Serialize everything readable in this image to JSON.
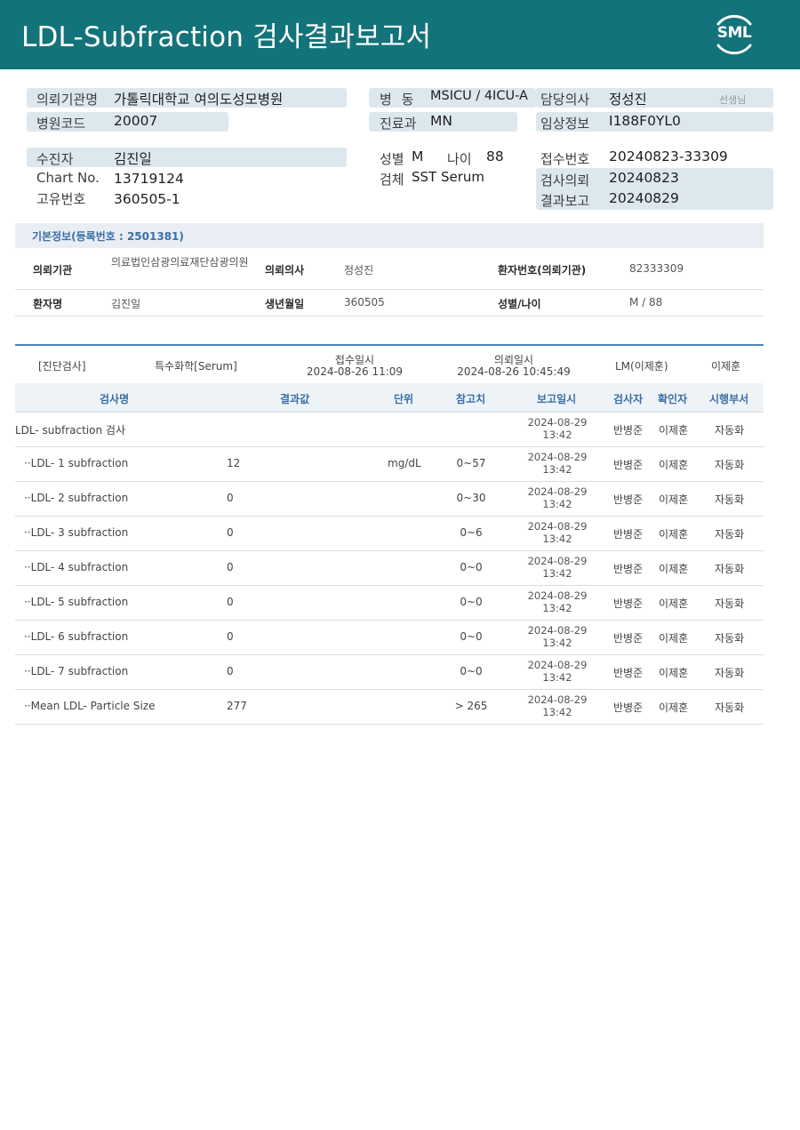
{
  "header": {
    "title": "LDL-Subfraction 검사결과보고서",
    "logo_text": "SML"
  },
  "info": {
    "institution_label": "의뢰기관명",
    "institution_value": "가톨릭대학교 여의도성모병원",
    "hospital_code_label": "병원코드",
    "hospital_code_value": "20007",
    "ward_label": "병  동",
    "ward_value": "MSICU / 4ICU-A",
    "dept_label": "진료과",
    "dept_value": "MN",
    "doctor_label": "담당의사",
    "doctor_value": "정성진",
    "doctor_suffix": "선생님",
    "clinical_label": "임상정보",
    "clinical_value": "I188F0YL0",
    "patient_label": "수진자",
    "patient_value": "김진일",
    "chart_label": "Chart No.",
    "chart_value": "13719124",
    "unique_label": "고유번호",
    "unique_value": "360505-1",
    "sex_label": "성별",
    "sex_value": "M",
    "age_label": "나이",
    "age_value": "88",
    "specimen_label": "검체",
    "specimen_value": "SST Serum",
    "receipt_label": "접수번호",
    "receipt_value": "20240823-33309",
    "request_label": "검사의뢰",
    "request_value": "20240823",
    "report_label": "결과보고",
    "report_value": "20240829"
  },
  "basic": {
    "section_title": "기본정보(등록번호 : 2501381)",
    "inst_label": "의뢰기관",
    "inst_value": "의료법인삼광의료재단삼광의원",
    "req_doctor_label": "의뢰의사",
    "req_doctor_value": "정성진",
    "patient_no_label": "환자번호(의뢰기관)",
    "patient_no_value": "82333309",
    "name_label": "환자명",
    "name_value": "김진일",
    "birth_label": "생년월일",
    "birth_value": "360505",
    "sex_age_label": "성별/나이",
    "sex_age_value": "M / 88"
  },
  "test_header": {
    "category": "[진단검사]",
    "type": "특수화학[Serum]",
    "received_label": "접수일시",
    "received_value": "2024-08-26 11:09",
    "requested_label": "의뢰일시",
    "requested_value": "2024-08-26 10:45:49",
    "lm": "LM(이제훈)",
    "confirmer": "이제훈"
  },
  "columns": {
    "name": "검사명",
    "result": "결과값",
    "unit": "단위",
    "reference": "참고치",
    "report_time": "보고일시",
    "tester": "검사자",
    "confirmer": "확인자",
    "dept": "시행부서"
  },
  "rows": [
    {
      "name": "LDL- subfraction 검사",
      "result": "",
      "unit": "",
      "ref": "",
      "date": "2024-08-29",
      "time": "13:42",
      "tester": "반병준",
      "confirmer": "이제훈",
      "dept": "자동화"
    },
    {
      "name": "··LDL- 1 subfraction",
      "result": "12",
      "unit": "mg/dL",
      "ref": "0~57",
      "date": "2024-08-29",
      "time": "13:42",
      "tester": "반병준",
      "confirmer": "이제훈",
      "dept": "자동화"
    },
    {
      "name": "··LDL- 2 subfraction",
      "result": "0",
      "unit": "",
      "ref": "0~30",
      "date": "2024-08-29",
      "time": "13:42",
      "tester": "반병준",
      "confirmer": "이제훈",
      "dept": "자동화"
    },
    {
      "name": "··LDL- 3 subfraction",
      "result": "0",
      "unit": "",
      "ref": "0~6",
      "date": "2024-08-29",
      "time": "13:42",
      "tester": "반병준",
      "confirmer": "이제훈",
      "dept": "자동화"
    },
    {
      "name": "··LDL- 4 subfraction",
      "result": "0",
      "unit": "",
      "ref": "0~0",
      "date": "2024-08-29",
      "time": "13:42",
      "tester": "반병준",
      "confirmer": "이제훈",
      "dept": "자동화"
    },
    {
      "name": "··LDL- 5 subfraction",
      "result": "0",
      "unit": "",
      "ref": "0~0",
      "date": "2024-08-29",
      "time": "13:42",
      "tester": "반병준",
      "confirmer": "이제훈",
      "dept": "자동화"
    },
    {
      "name": "··LDL- 6 subfraction",
      "result": "0",
      "unit": "",
      "ref": "0~0",
      "date": "2024-08-29",
      "time": "13:42",
      "tester": "반병준",
      "confirmer": "이제훈",
      "dept": "자동화"
    },
    {
      "name": "··LDL- 7 subfraction",
      "result": "0",
      "unit": "",
      "ref": "0~0",
      "date": "2024-08-29",
      "time": "13:42",
      "tester": "반병준",
      "confirmer": "이제훈",
      "dept": "자동화"
    },
    {
      "name": "··Mean LDL- Particle Size",
      "result": "277",
      "unit": "",
      "ref": "> 265",
      "date": "2024-08-29",
      "time": "13:42",
      "tester": "반병준",
      "confirmer": "이제훈",
      "dept": "자동화"
    }
  ]
}
